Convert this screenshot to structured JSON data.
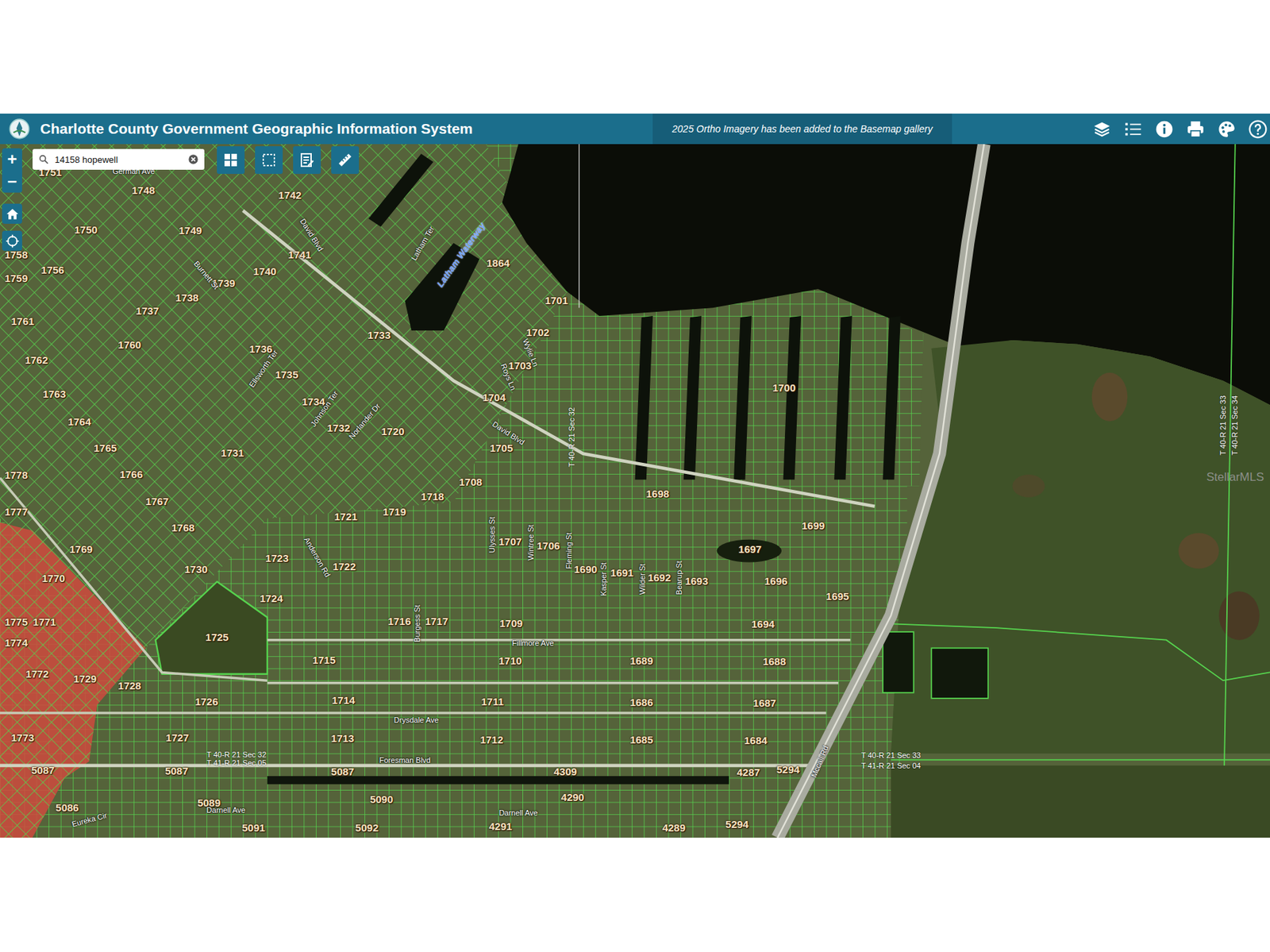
{
  "header": {
    "title": "Charlotte County Government Geographic Information System",
    "notice": "2025 Ortho Imagery has been added to the Basemap gallery"
  },
  "search": {
    "value": "14158 hopewell"
  },
  "zoom": [
    "+",
    "−"
  ],
  "map": {
    "parcels": [
      "1748",
      "1742",
      "1750",
      "1749",
      "1758",
      "1741",
      "1864",
      "1756",
      "1740",
      "1759",
      "1739",
      "1738",
      "1701",
      "1737",
      "1761",
      "1733",
      "1702",
      "1760",
      "1736",
      "1762",
      "1703",
      "1735",
      "1700",
      "1763",
      "1704",
      "1734",
      "1764",
      "1732",
      "1720",
      "1705",
      "1765",
      "1731",
      "1778",
      "1766",
      "1708",
      "1718",
      "1698",
      "1767",
      "1777",
      "1719",
      "1721",
      "1699",
      "1768",
      "1707",
      "1706",
      "1697",
      "1769",
      "1723",
      "1722",
      "1730",
      "1690",
      "1691",
      "1692",
      "1770",
      "1693",
      "1696",
      "1695",
      "1724",
      "1775",
      "1771",
      "1716",
      "1717",
      "1709",
      "1694",
      "1725",
      "1774",
      "1715",
      "1710",
      "1689",
      "1688",
      "1772",
      "1729",
      "1728",
      "1726",
      "1714",
      "1711",
      "1686",
      "1687",
      "1773",
      "1727",
      "1713",
      "1712",
      "1685",
      "1684",
      "5087",
      "5087",
      "5087",
      "4309",
      "4287",
      "5294",
      "5089",
      "5090",
      "4290",
      "5086",
      "5091",
      "5092",
      "4291",
      "4289",
      "5294",
      "1751"
    ],
    "streets": [
      "German Ave",
      "David Blvd",
      "David Blvd",
      "Latham Ter",
      "Burnett St",
      "Norlander Dr",
      "Johnson Ter",
      "Ellsworth Ter",
      "Anderson Rd",
      "Ulysses St",
      "Wintree St",
      "Fleming St",
      "Kasper St",
      "Wilder St",
      "Bearup St",
      "Burgess St",
      "Fillmore Ave",
      "Drysdale Ave",
      "Foresman Blvd",
      "Darnell Ave",
      "Darnell Ave",
      "Eureka Cir",
      "Mccall Rd",
      "Wylie Ln",
      "Roys Ln"
    ],
    "waterways": [
      "Latham Waterway"
    ],
    "sections": [
      "T 40-R 21 Sec 32",
      "T 40-R 21 Sec 32",
      "T 41-R 21 Sec 05",
      "T 40-R 21 Sec 33",
      "T 41-R 21 Sec 04",
      "T 40-R 21 Sec 33",
      "T 40-R 21 Sec 34"
    ]
  },
  "watermark": "StellarMLS"
}
